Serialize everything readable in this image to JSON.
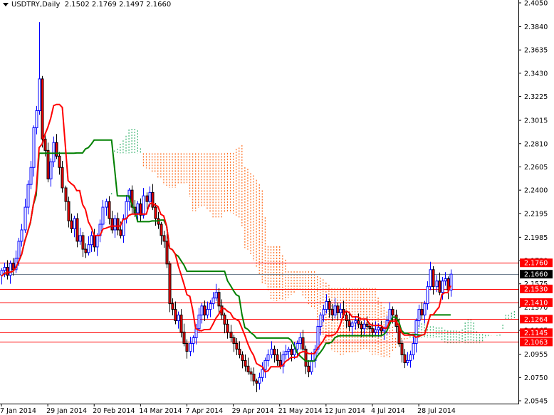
{
  "header": {
    "symbol": "USDTRY,Daily",
    "ohlc": "2.1502 2.1769 2.1497 2.1660"
  },
  "colors": {
    "bull": "#0000ff",
    "bear_fill": "#ff0000",
    "tenkan": "#ff0000",
    "kijun": "#008000",
    "cloud_bear": "#ff6a1a",
    "cloud_bull": "#3cb371",
    "level": "#ff0000",
    "current": "#708090"
  },
  "chart_data": {
    "type": "candlestick",
    "title": "USDTRY,Daily",
    "ylim": [
      2.0545,
      2.405
    ],
    "y_ticks": [
      "2.4050",
      "2.3840",
      "2.3635",
      "2.3430",
      "2.3225",
      "2.3015",
      "2.2810",
      "2.2605",
      "2.2400",
      "2.2195",
      "2.1985",
      "2.1780",
      "2.1575",
      "2.1370",
      "2.1165",
      "2.0955",
      "2.0750",
      "2.0545"
    ],
    "x_labels": [
      {
        "bar": 0,
        "label": "7 Jan 2014"
      },
      {
        "bar": 16,
        "label": "29 Jan 2014"
      },
      {
        "bar": 32,
        "label": "20 Feb 2014"
      },
      {
        "bar": 48,
        "label": "14 Mar 2014"
      },
      {
        "bar": 64,
        "label": "7 Apr 2014"
      },
      {
        "bar": 80,
        "label": "29 Apr 2014"
      },
      {
        "bar": 96,
        "label": "21 May 2014"
      },
      {
        "bar": 112,
        "label": "12 Jun 2014"
      },
      {
        "bar": 128,
        "label": "4 Jul 2014"
      },
      {
        "bar": 144,
        "label": "28 Jul 2014"
      }
    ],
    "close": [
      2.1693,
      2.172,
      2.165,
      2.1755,
      2.17,
      2.18,
      2.195,
      2.205,
      2.225,
      2.245,
      2.26,
      2.295,
      2.31,
      2.338,
      2.285,
      2.275,
      2.25,
      2.265,
      2.282,
      2.27,
      2.26,
      2.242,
      2.23,
      2.213,
      2.206,
      2.215,
      2.195,
      2.2,
      2.188,
      2.185,
      2.192,
      2.2,
      2.19,
      2.2,
      2.21,
      2.225,
      2.23,
      2.215,
      2.205,
      2.215,
      2.205,
      2.2,
      2.215,
      2.23,
      2.24,
      2.225,
      2.22,
      2.228,
      2.218,
      2.235,
      2.23,
      2.238,
      2.225,
      2.215,
      2.21,
      2.2,
      2.195,
      2.175,
      2.14,
      2.135,
      2.125,
      2.13,
      2.115,
      2.105,
      2.098,
      2.105,
      2.11,
      2.118,
      2.13,
      2.138,
      2.13,
      2.135,
      2.14,
      2.145,
      2.15,
      2.138,
      2.13,
      2.122,
      2.115,
      2.11,
      2.105,
      2.1,
      2.095,
      2.09,
      2.085,
      2.08,
      2.078,
      2.072,
      2.07,
      2.075,
      2.082,
      2.09,
      2.095,
      2.1,
      2.095,
      2.09,
      2.085,
      2.095,
      2.098,
      2.1,
      2.095,
      2.1,
      2.105,
      2.11,
      2.1,
      2.085,
      2.08,
      2.09,
      2.1,
      2.12,
      2.13,
      2.135,
      2.142,
      2.135,
      2.13,
      2.138,
      2.132,
      2.135,
      2.13,
      2.125,
      2.12,
      2.123,
      2.125,
      2.122,
      2.118,
      2.122,
      2.12,
      2.118,
      2.115,
      2.117,
      2.119,
      2.116,
      2.118,
      2.125,
      2.135,
      2.13,
      2.12,
      2.105,
      2.095,
      2.088,
      2.09,
      2.095,
      2.105,
      2.125,
      2.135,
      2.13,
      2.14,
      2.155,
      2.17,
      2.155,
      2.16,
      2.15,
      2.16,
      2.162,
      2.152,
      2.166
    ],
    "first_open": 2.165,
    "spike_high": {
      "bar": 13,
      "value": 2.388
    },
    "levels": [
      {
        "value": 2.176,
        "label": "2.1760"
      },
      {
        "value": 2.153,
        "label": "2.1530"
      },
      {
        "value": 2.141,
        "label": "2.1410"
      },
      {
        "value": 2.1264,
        "label": "2.1264"
      },
      {
        "value": 2.1145,
        "label": "2.1145"
      },
      {
        "value": 2.1063,
        "label": "2.1063"
      }
    ],
    "current_price": {
      "value": 2.166,
      "label": "2.1660"
    },
    "indicators": {
      "tenkan_period": 9,
      "kijun_period": 26,
      "senkou_b_period": 52,
      "shift": 26
    }
  }
}
